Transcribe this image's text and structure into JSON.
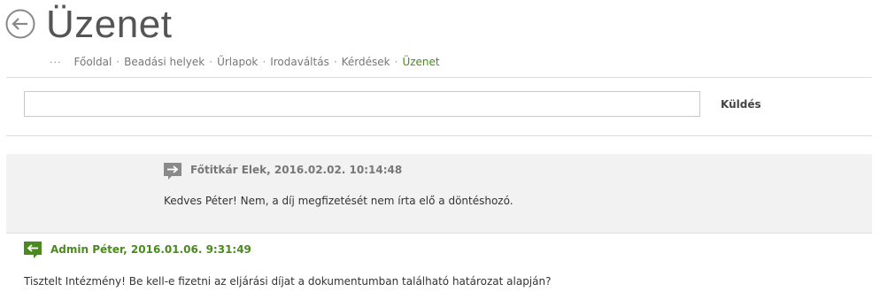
{
  "page": {
    "title": "Üzenet"
  },
  "breadcrumb": {
    "ellipsis": "···",
    "items": [
      {
        "label": "Főoldal"
      },
      {
        "label": "Beadási helyek"
      },
      {
        "label": "Űrlapok"
      },
      {
        "label": "Irodaváltás"
      },
      {
        "label": "Kérdések"
      },
      {
        "label": "Üzenet"
      }
    ],
    "separator": "·"
  },
  "compose": {
    "input_value": "",
    "placeholder": "",
    "send_label": "Küldés"
  },
  "messages": [
    {
      "direction": "incoming",
      "icon": "arrow-right-speech-icon",
      "sender_meta": "Főtitkár Elek, 2016.02.02. 10:14:48",
      "text": "Kedves Péter! Nem, a díj megfizetését nem írta elő a döntéshozó."
    },
    {
      "direction": "outgoing",
      "icon": "arrow-left-speech-icon",
      "sender_meta": "Admin Péter, 2016.01.06. 9:31:49",
      "text": "Tisztelt Intézmény! Be kell-e fizetni az eljárási díjat a dokumentumban található határozat alapján?"
    }
  ],
  "colors": {
    "accent_green": "#4a8a1e",
    "incoming_bg": "#f2f2f2",
    "title_gray": "#555555",
    "icon_gray": "#888888"
  }
}
